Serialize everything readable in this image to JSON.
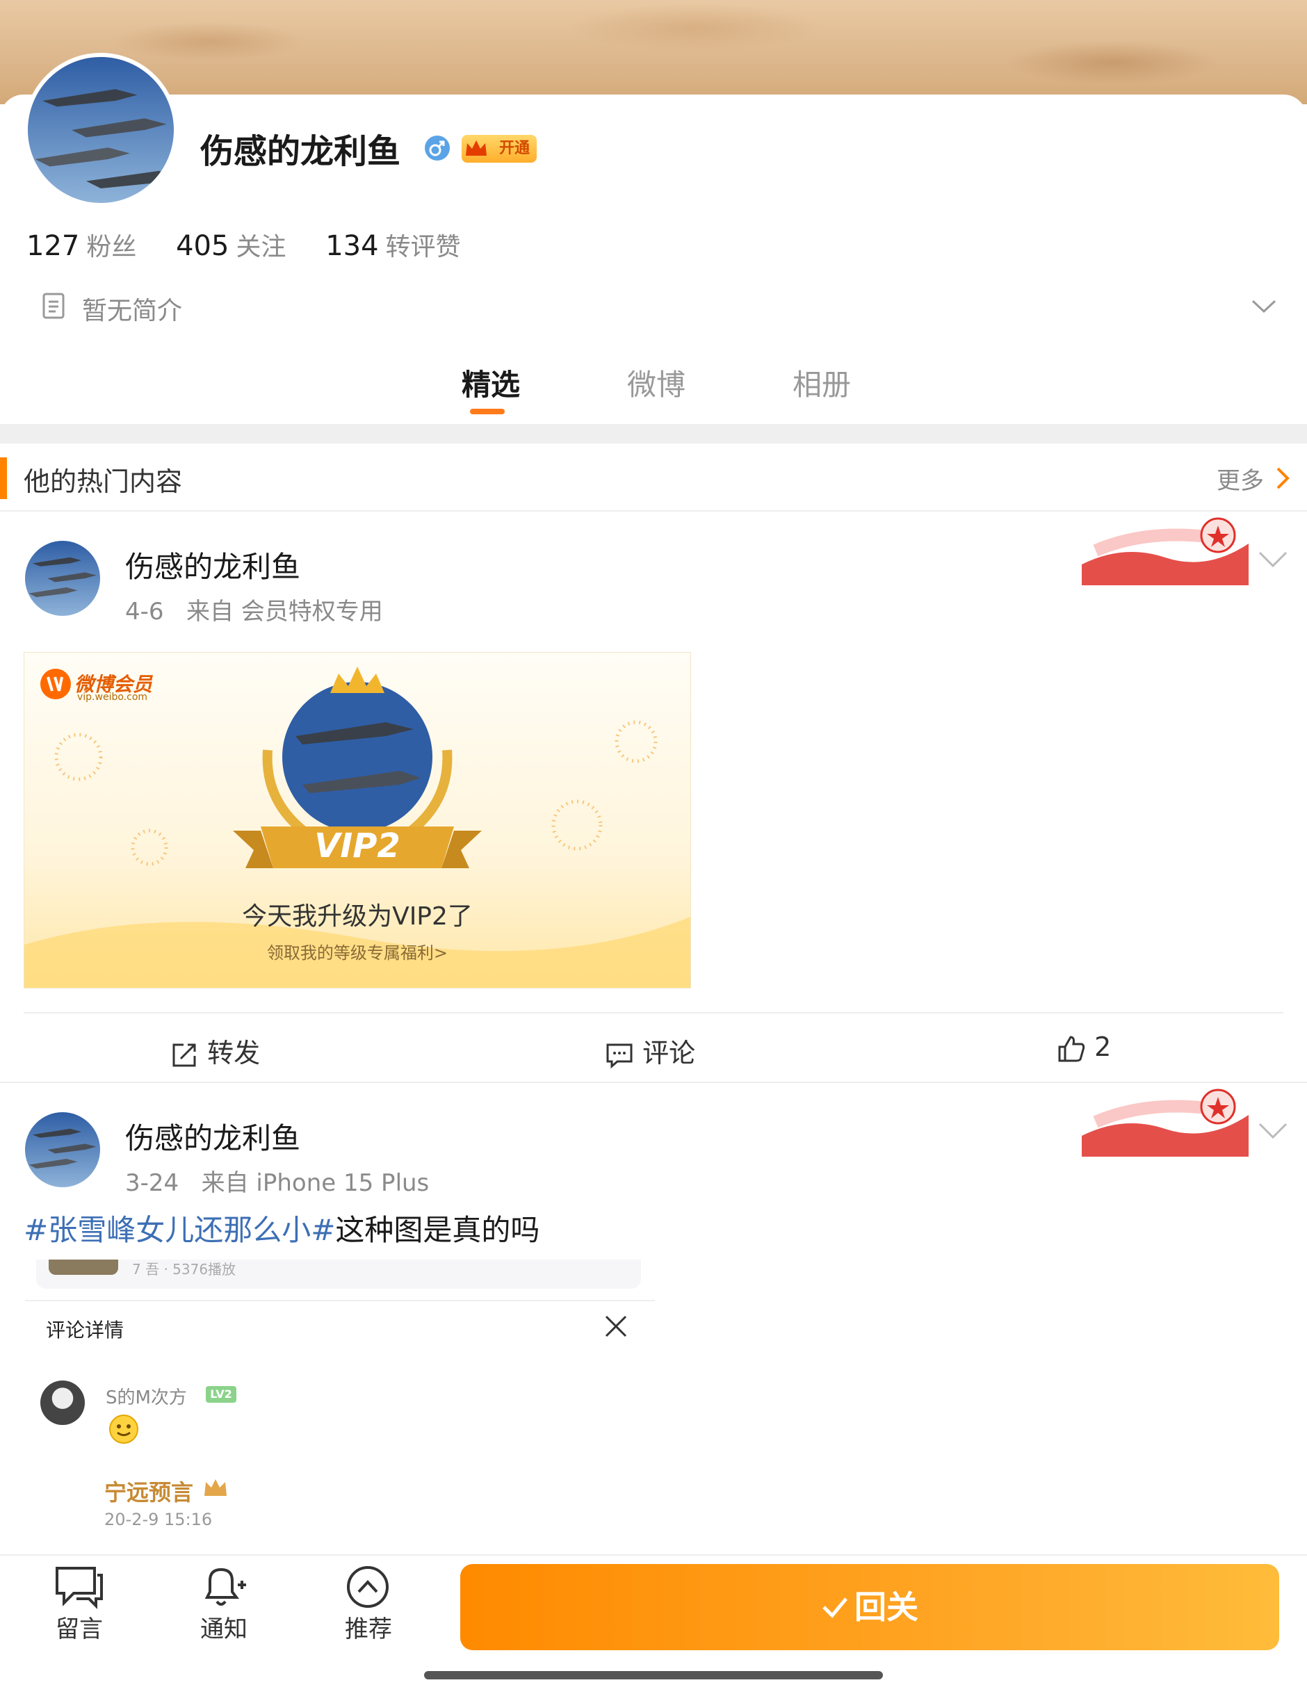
{
  "profile": {
    "name": "伤感的龙利鱼",
    "vip_badge": "开通",
    "stats": [
      {
        "num": "127",
        "label": "粉丝"
      },
      {
        "num": "405",
        "label": "关注"
      },
      {
        "num": "134",
        "label": "转评赞"
      }
    ],
    "bio": "暂无简介"
  },
  "tabs": [
    {
      "label": "精选",
      "active": true
    },
    {
      "label": "微博",
      "active": false
    },
    {
      "label": "相册",
      "active": false
    }
  ],
  "section": {
    "title": "他的热门内容",
    "more": "更多"
  },
  "post1": {
    "name": "伤感的龙利鱼",
    "date": "4-6",
    "source": "来自 会员特权专用",
    "image": {
      "logo": "微博会员",
      "logo_sub": "vip.weibo.com",
      "ribbon": "VIP2",
      "title": "今天我升级为VIP2了",
      "subtitle": "领取我的等级专属福利>"
    },
    "actions": {
      "repost": "转发",
      "comment": "评论",
      "like": "2"
    }
  },
  "post2": {
    "name": "伤感的龙利鱼",
    "date": "3-24",
    "source": "来自 iPhone 15 Plus",
    "hashtag": "#张雪峰女儿还那么小#",
    "text": "这种图是真的吗",
    "embed": {
      "small_text": "7 吾 · 5376播放",
      "comment_title": "评论详情",
      "commenter": "S的M次方",
      "level": "LV2",
      "reply_user": "宁远预言",
      "reply_time": "20-2-9 15:16"
    }
  },
  "bottom_bar": {
    "items": [
      {
        "label": "留言",
        "icon": "message-icon"
      },
      {
        "label": "通知",
        "icon": "bell-plus-icon"
      },
      {
        "label": "推荐",
        "icon": "chevron-up-circle-icon"
      }
    ],
    "follow_back": "回关"
  },
  "colors": {
    "accent": "#ff8200",
    "hashtag": "#3d6fb5",
    "follow_back_button": "#ff9a14"
  }
}
